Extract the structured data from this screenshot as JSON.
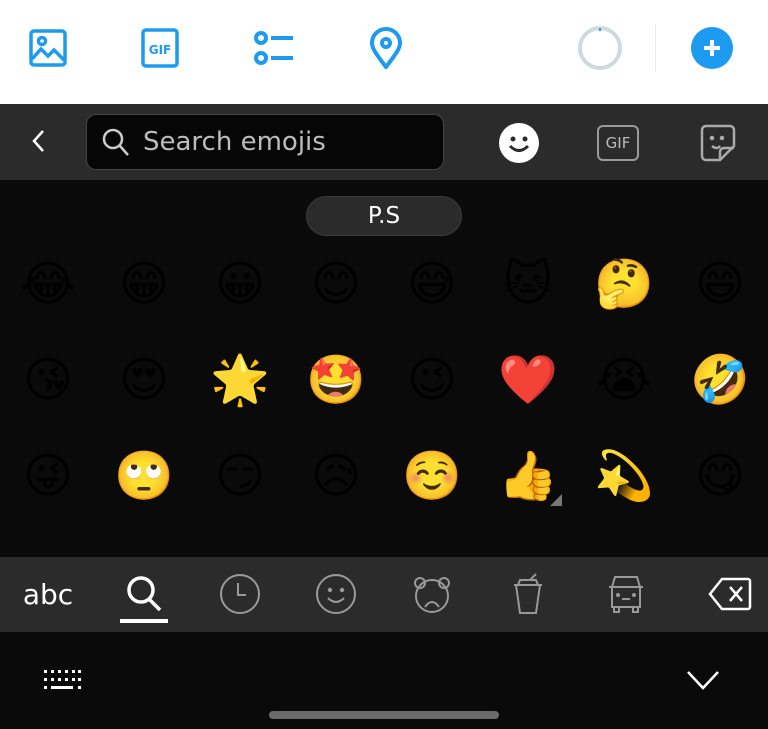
{
  "toolbar": {
    "icons": [
      "image-icon",
      "gif-icon",
      "poll-icon",
      "location-icon",
      "char-count-ring",
      "add-tweet-button"
    ],
    "gif_label": "GIF",
    "accent": "#1d9bf0"
  },
  "emoji_header": {
    "search_placeholder": "Search emojis",
    "gif_tab": "GIF"
  },
  "section": {
    "label": "P.S"
  },
  "emojis": [
    "😂",
    "😁",
    "😀",
    "😊",
    "😅",
    "🐱",
    "🤔",
    "😄",
    "😘",
    "😍",
    "🌟",
    "🤩",
    "😉",
    "❤️",
    "😭",
    "🤣",
    "😜",
    "🙄",
    "😏",
    "😥",
    "☺️",
    "👍",
    "💫",
    "😋"
  ],
  "categories": {
    "abc": "abc",
    "active": "search"
  }
}
